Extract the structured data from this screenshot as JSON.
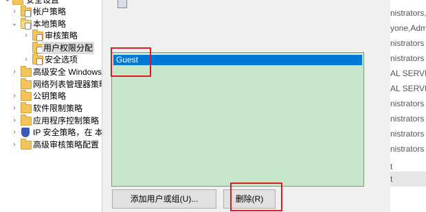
{
  "tree": {
    "items": [
      {
        "label": "安全设置",
        "level": 0,
        "icon": "shield-folder-icon",
        "chev": "expanded"
      },
      {
        "label": "帐户策略",
        "level": 1,
        "icon": "folder-icon",
        "chev": "collapsed"
      },
      {
        "label": "本地策略",
        "level": 1,
        "icon": "folder-open-icon",
        "chev": "expanded"
      },
      {
        "label": "审核策略",
        "level": 2,
        "icon": "folder-icon",
        "chev": "collapsed"
      },
      {
        "label": "用户权限分配",
        "level": 2,
        "icon": "folder-icon",
        "chev": "none",
        "selected": true
      },
      {
        "label": "安全选项",
        "level": 2,
        "icon": "folder-icon",
        "chev": "collapsed"
      },
      {
        "label": "高级安全 Windows",
        "level": 1,
        "icon": "folder-icon",
        "chev": "collapsed"
      },
      {
        "label": "网络列表管理器策略",
        "level": 1,
        "icon": "folder-icon",
        "chev": "none"
      },
      {
        "label": "公钥策略",
        "level": 1,
        "icon": "folder-icon",
        "chev": "collapsed"
      },
      {
        "label": "软件限制策略",
        "level": 1,
        "icon": "folder-icon",
        "chev": "collapsed"
      },
      {
        "label": "应用程序控制策略",
        "level": 1,
        "icon": "folder-icon",
        "chev": "collapsed"
      },
      {
        "label": "IP 安全策略，在 本地",
        "level": 1,
        "icon": "shield-icon",
        "chev": "collapsed"
      },
      {
        "label": "高级审核策略配置",
        "level": 1,
        "icon": "folder-icon",
        "chev": "collapsed"
      }
    ]
  },
  "dialog": {
    "list_items": [
      "Guest"
    ],
    "add_button_label": "添加用户或组(U)...",
    "remove_button_label": "删除(R)"
  },
  "right_panel": {
    "rows": [
      "nistrators,",
      "yone,Admi",
      "nistrators",
      "nistrators",
      "AL SERVICE",
      "AL SERVICE",
      "nistrators",
      "nistrators",
      "nistrators",
      "nistrators",
      "t",
      "t"
    ]
  },
  "colors": {
    "selection": "#0078d7",
    "list_background": "#c8e6c9",
    "highlight_box": "#e0191c"
  }
}
